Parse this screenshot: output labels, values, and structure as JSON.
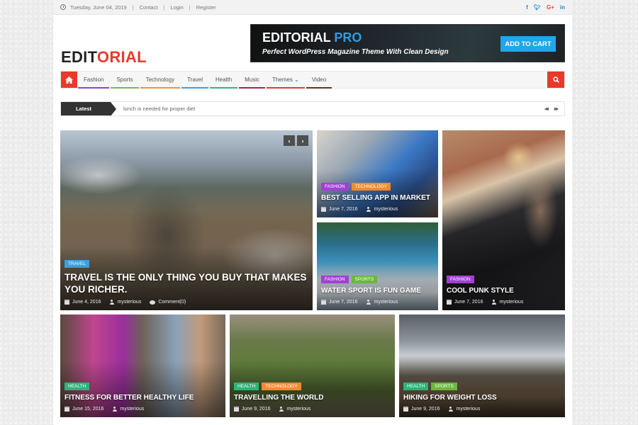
{
  "topbar": {
    "date": "Tuesday, June 04, 2019",
    "links": [
      "Contact",
      "Login",
      "Register"
    ],
    "social": [
      "f",
      "t",
      "G+",
      "in"
    ]
  },
  "header": {
    "logo_part1": "EDIT",
    "logo_part2": "ORIAL",
    "banner": {
      "title": "EDITORIAL",
      "title_accent": "PRO",
      "tagline": "Perfect  WordPress Magazine Theme With Clean Design",
      "cta": "ADD TO CART"
    }
  },
  "nav": {
    "items": [
      {
        "label": "Fashion",
        "color": "#9b3fc9"
      },
      {
        "label": "Sports",
        "color": "#7ab648"
      },
      {
        "label": "Technology",
        "color": "#f0903a"
      },
      {
        "label": "Travel",
        "color": "#3aa0e0"
      },
      {
        "label": "Health",
        "color": "#36b37e"
      },
      {
        "label": "Music",
        "color": "#a0244e"
      },
      {
        "label": "Themes ⌄",
        "color": "#e8392b"
      },
      {
        "label": "Video",
        "color": "#5a3a22"
      }
    ]
  },
  "ticker": {
    "label": "Latest",
    "text": "lunch is needed for proper diet",
    "prev": "◀◀",
    "next": "▶▶"
  },
  "category_colors": {
    "TRAVEL": "#3aa0e0",
    "FASHION": "#a33fd6",
    "TECHNOLOGY": "#f28a2e",
    "SPORTS": "#6ab83c",
    "HEALTH": "#2fb27a"
  },
  "posts": [
    {
      "title": "TRAVEL IS THE ONLY THING YOU BUY THAT MAKES YOU RICHER.",
      "cats": [
        "TRAVEL"
      ],
      "date": "June 4, 2016",
      "author": "mysterious",
      "comments": "Comment(0)"
    },
    {
      "title": "BEST SELLING APP IN MARKET",
      "cats": [
        "FASHION",
        "TECHNOLOGY"
      ],
      "date": "June 7, 2016",
      "author": "mysterious"
    },
    {
      "title": "WATER SPORT IS FUN GAME",
      "cats": [
        "FASHION",
        "SPORTS"
      ],
      "date": "June 7, 2016",
      "author": "mysterious"
    },
    {
      "title": "COOL PUNK STYLE",
      "cats": [
        "FASHION"
      ],
      "date": "June 7, 2016",
      "author": "mysterious"
    },
    {
      "title": "FITNESS FOR BETTER HEALTHY LIFE",
      "cats": [
        "HEALTH"
      ],
      "date": "June 15, 2016",
      "author": "mysterious"
    },
    {
      "title": "TRAVELLING THE WORLD",
      "cats": [
        "HEALTH",
        "TECHNOLOGY"
      ],
      "date": "June 9, 2016",
      "author": "mysterious"
    },
    {
      "title": "HIKING FOR WEIGHT LOSS",
      "cats": [
        "HEALTH",
        "SPORTS"
      ],
      "date": "June 9, 2016",
      "author": "mysterious"
    }
  ],
  "slider": {
    "prev": "‹",
    "next": "›"
  }
}
